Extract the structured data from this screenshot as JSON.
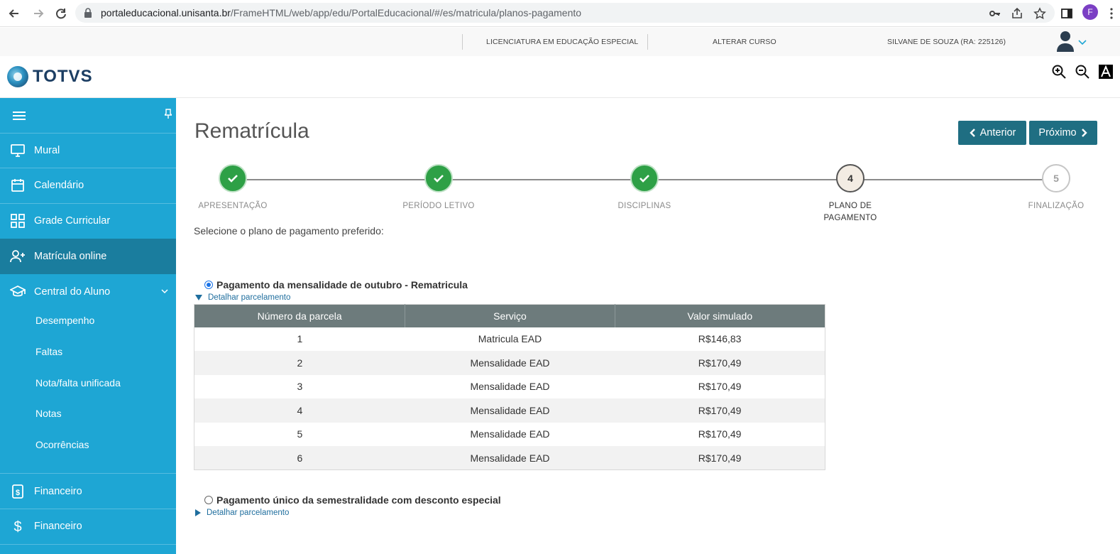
{
  "browser": {
    "url_host": "portaleducacional.unisanta.br",
    "url_path": "/FrameHTML/web/app/edu/PortalEducacional/#/es/matricula/planos-pagamento",
    "profile_initial": "F"
  },
  "topbar": {
    "course": "LICENCIATURA EM EDUCAÇÃO ESPECIAL",
    "change_course": "ALTERAR CURSO",
    "user": "SILVANE DE SOUZA (RA: 225126)"
  },
  "logo": {
    "text": "TOTVS"
  },
  "sidebar": {
    "items": [
      {
        "label": "Mural",
        "icon": "monitor-icon"
      },
      {
        "label": "Calendário",
        "icon": "calendar-icon"
      },
      {
        "label": "Grade Curricular",
        "icon": "grid-icon"
      },
      {
        "label": "Matrícula online",
        "icon": "user-plus-icon"
      },
      {
        "label": "Central do Aluno",
        "icon": "graduation-cap-icon"
      }
    ],
    "subitems": [
      "Desempenho",
      "Faltas",
      "Nota/falta unificada",
      "Notas",
      "Ocorrências"
    ],
    "bottom_items": [
      {
        "label": "Financeiro",
        "icon": "dollar-file-icon"
      },
      {
        "label": "Financeiro",
        "icon": "dollar-icon"
      }
    ]
  },
  "main": {
    "title": "Rematrícula",
    "prev_label": "Anterior",
    "next_label": "Próximo",
    "steps": [
      {
        "label": "APRESENTAÇÃO",
        "state": "done"
      },
      {
        "label": "PERÍODO LETIVO",
        "state": "done"
      },
      {
        "label": "DISCIPLINAS",
        "state": "done"
      },
      {
        "label": "PLANO DE PAGAMENTO",
        "state": "current",
        "number": "4"
      },
      {
        "label": "FINALIZAÇÃO",
        "state": "future",
        "number": "5"
      }
    ],
    "instruction": "Selecione o plano de pagamento preferido:",
    "plans": [
      {
        "label": "Pagamento da mensalidade de outubro - Rematricula",
        "selected": true,
        "detail": "Detalhar parcelamento"
      },
      {
        "label": "Pagamento único da semestralidade com desconto especial",
        "selected": false,
        "detail": "Detalhar parcelamento"
      }
    ],
    "table": {
      "headers": [
        "Número da parcela",
        "Serviço",
        "Valor simulado"
      ],
      "rows": [
        [
          "1",
          "Matricula EAD",
          "R$146,83"
        ],
        [
          "2",
          "Mensalidade EAD",
          "R$170,49"
        ],
        [
          "3",
          "Mensalidade EAD",
          "R$170,49"
        ],
        [
          "4",
          "Mensalidade EAD",
          "R$170,49"
        ],
        [
          "5",
          "Mensalidade EAD",
          "R$170,49"
        ],
        [
          "6",
          "Mensalidade EAD",
          "R$170,49"
        ]
      ]
    }
  },
  "colors": {
    "sidebar": "#1ea6d4",
    "sidebar_active": "#1a7d9e",
    "button": "#1f6e82",
    "step_done": "#2ea046",
    "table_header": "#6d7b7c"
  }
}
